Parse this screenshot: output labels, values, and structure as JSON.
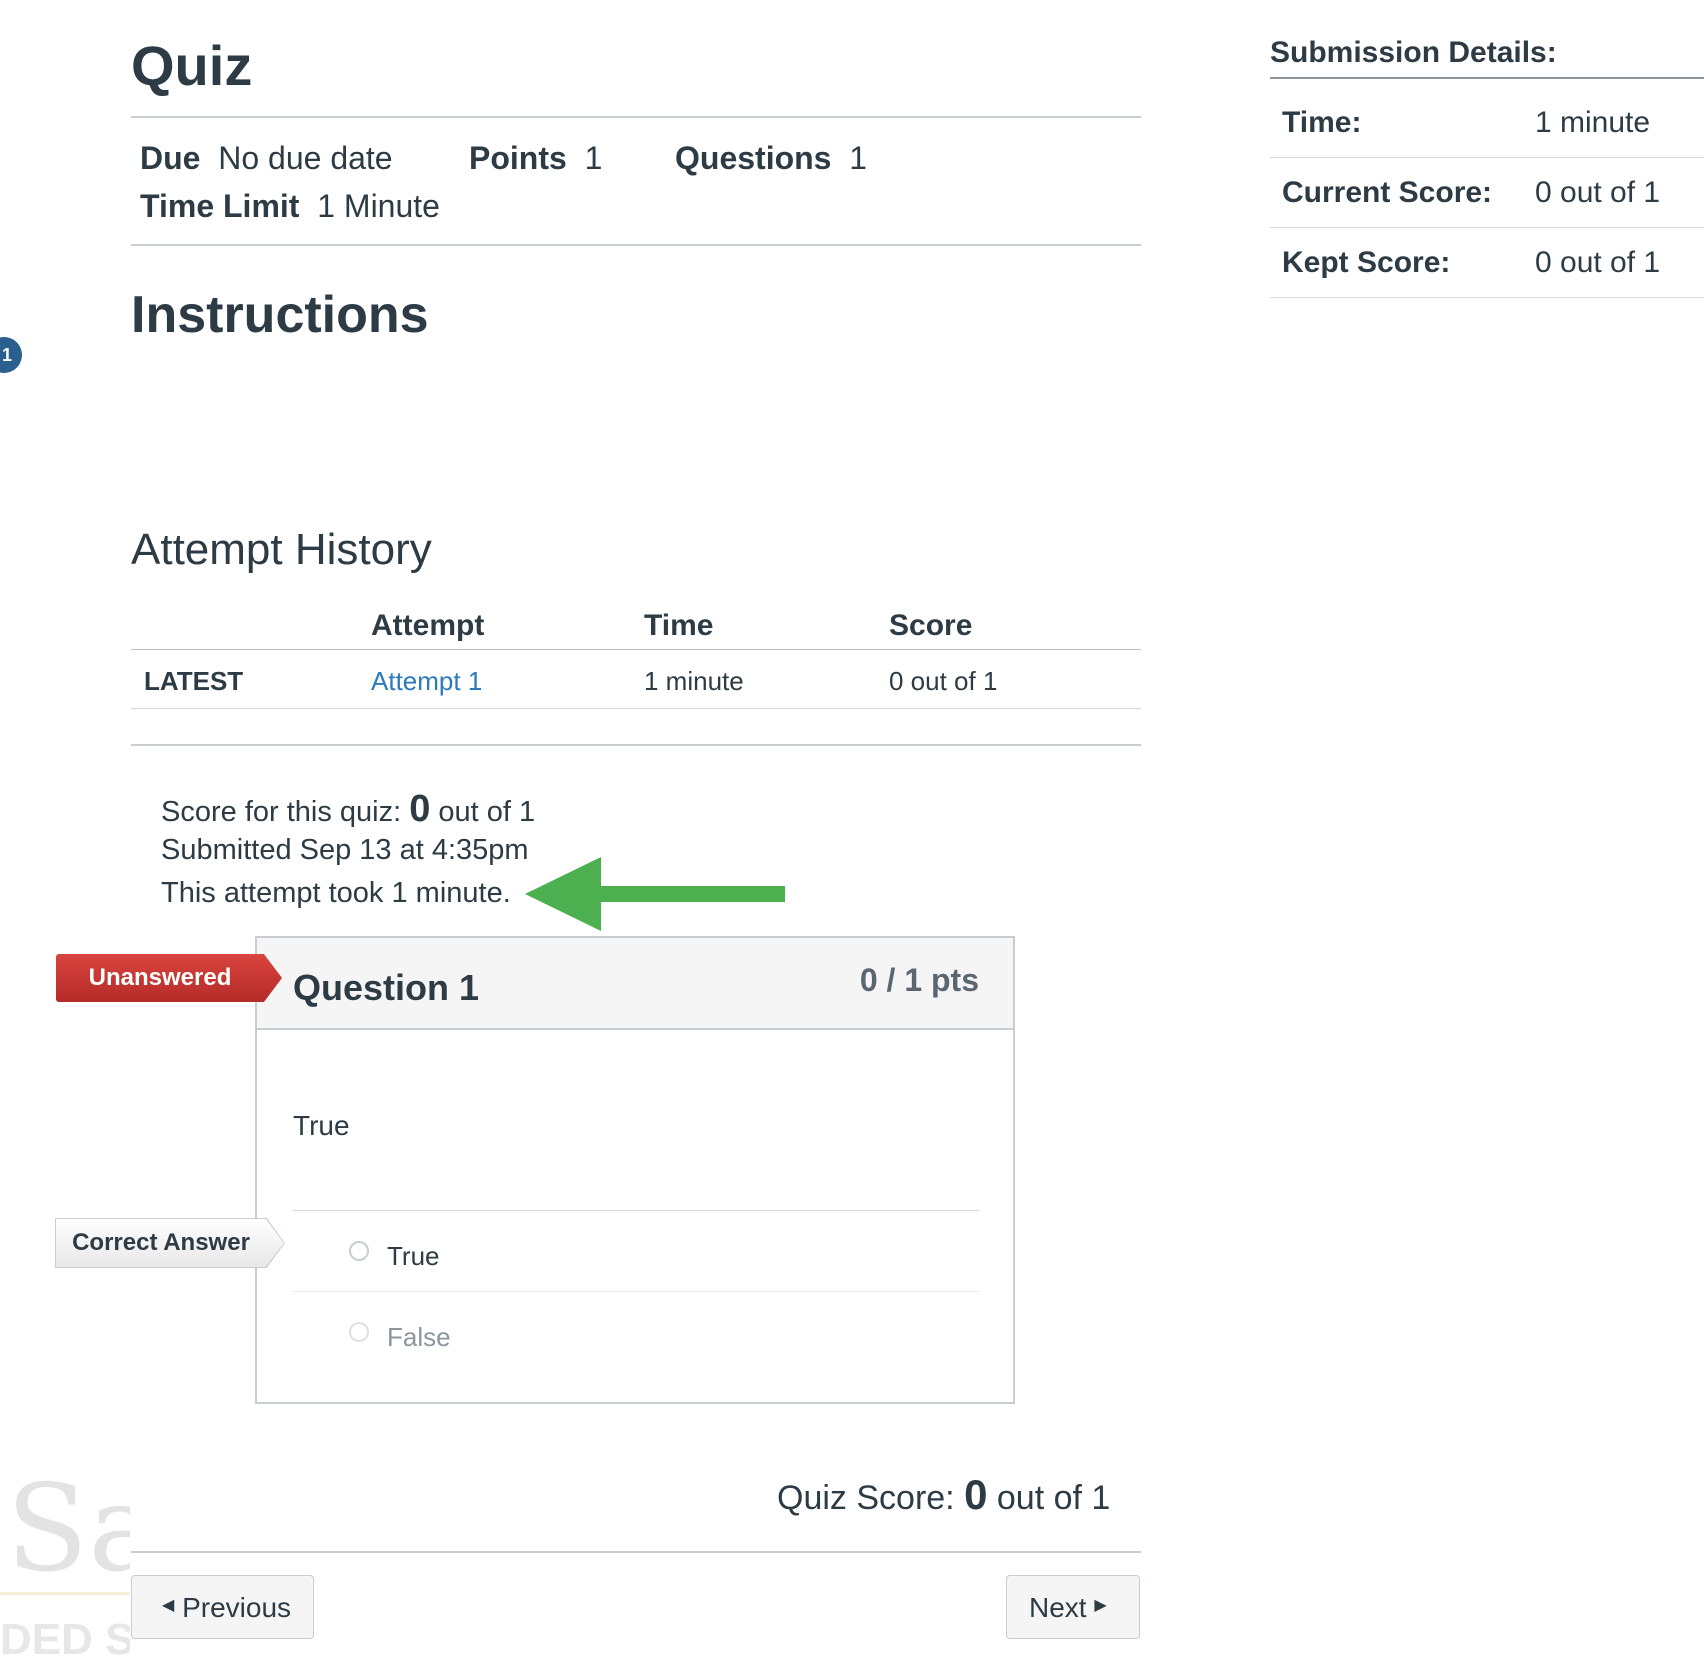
{
  "quiz": {
    "title": "Quiz",
    "meta": {
      "due_label": "Due",
      "due_value": "No due date",
      "points_label": "Points",
      "points_value": "1",
      "questions_label": "Questions",
      "questions_value": "1",
      "time_limit_label": "Time Limit",
      "time_limit_value": "1 Minute"
    },
    "instructions_title": "Instructions",
    "left_badge": "1"
  },
  "attempt_history": {
    "title": "Attempt History",
    "headers": [
      "",
      "Attempt",
      "Time",
      "Score"
    ],
    "rows": [
      {
        "tag": "LATEST",
        "attempt": "Attempt 1",
        "time": "1 minute",
        "score": "0 out of 1"
      }
    ]
  },
  "result": {
    "score_prefix": "Score for this quiz:",
    "score_value": "0",
    "score_suffix": "out of 1",
    "submitted": "Submitted Sep 13 at 4:35pm",
    "duration": "This attempt took 1 minute."
  },
  "question": {
    "flag": "Unanswered",
    "title": "Question 1",
    "points": "0 / 1 pts",
    "text": "True",
    "correct_label": "Correct Answer",
    "answers": [
      "True",
      "False"
    ]
  },
  "footer": {
    "score_prefix": "Quiz Score:",
    "score_value": "0",
    "score_suffix": "out of 1",
    "previous": "Previous",
    "next": "Next"
  },
  "watermark": {
    "text": "Sa",
    "subtext": "DED S"
  },
  "submission": {
    "title": "Submission Details:",
    "rows": [
      {
        "label": "Time:",
        "value": "1 minute"
      },
      {
        "label": "Current Score:",
        "value": "0 out of 1"
      },
      {
        "label": "Kept Score:",
        "value": "0 out of 1"
      }
    ]
  },
  "colors": {
    "text": "#2d3b45",
    "link": "#2b7abc",
    "unanswered": "#c0392b",
    "arrow": "#4caf50",
    "border": "#c7cdd1"
  }
}
